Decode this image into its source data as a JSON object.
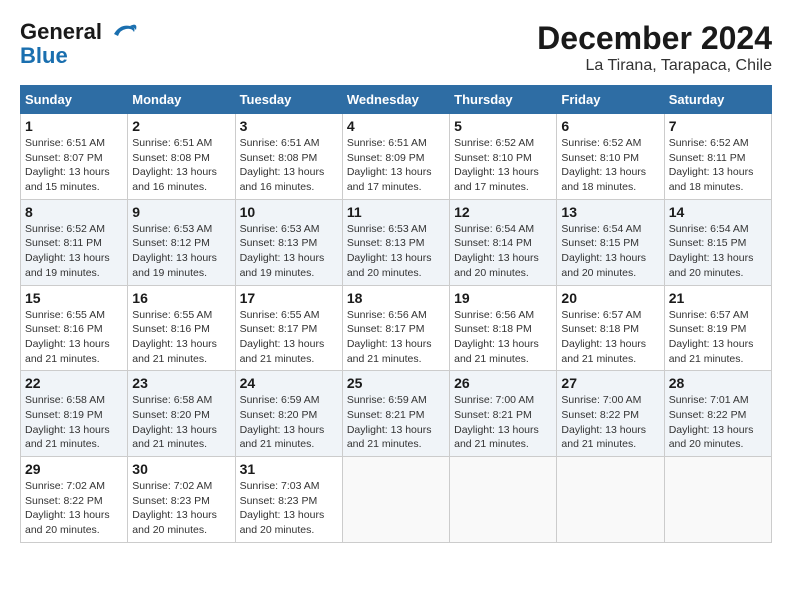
{
  "logo": {
    "line1": "General",
    "line2": "Blue"
  },
  "title": "December 2024",
  "subtitle": "La Tirana, Tarapaca, Chile",
  "days_of_week": [
    "Sunday",
    "Monday",
    "Tuesday",
    "Wednesday",
    "Thursday",
    "Friday",
    "Saturday"
  ],
  "weeks": [
    [
      {
        "day": "1",
        "sunrise": "6:51 AM",
        "sunset": "8:07 PM",
        "daylight": "13 hours and 15 minutes."
      },
      {
        "day": "2",
        "sunrise": "6:51 AM",
        "sunset": "8:08 PM",
        "daylight": "13 hours and 16 minutes."
      },
      {
        "day": "3",
        "sunrise": "6:51 AM",
        "sunset": "8:08 PM",
        "daylight": "13 hours and 16 minutes."
      },
      {
        "day": "4",
        "sunrise": "6:51 AM",
        "sunset": "8:09 PM",
        "daylight": "13 hours and 17 minutes."
      },
      {
        "day": "5",
        "sunrise": "6:52 AM",
        "sunset": "8:10 PM",
        "daylight": "13 hours and 17 minutes."
      },
      {
        "day": "6",
        "sunrise": "6:52 AM",
        "sunset": "8:10 PM",
        "daylight": "13 hours and 18 minutes."
      },
      {
        "day": "7",
        "sunrise": "6:52 AM",
        "sunset": "8:11 PM",
        "daylight": "13 hours and 18 minutes."
      }
    ],
    [
      {
        "day": "8",
        "sunrise": "6:52 AM",
        "sunset": "8:11 PM",
        "daylight": "13 hours and 19 minutes."
      },
      {
        "day": "9",
        "sunrise": "6:53 AM",
        "sunset": "8:12 PM",
        "daylight": "13 hours and 19 minutes."
      },
      {
        "day": "10",
        "sunrise": "6:53 AM",
        "sunset": "8:13 PM",
        "daylight": "13 hours and 19 minutes."
      },
      {
        "day": "11",
        "sunrise": "6:53 AM",
        "sunset": "8:13 PM",
        "daylight": "13 hours and 20 minutes."
      },
      {
        "day": "12",
        "sunrise": "6:54 AM",
        "sunset": "8:14 PM",
        "daylight": "13 hours and 20 minutes."
      },
      {
        "day": "13",
        "sunrise": "6:54 AM",
        "sunset": "8:15 PM",
        "daylight": "13 hours and 20 minutes."
      },
      {
        "day": "14",
        "sunrise": "6:54 AM",
        "sunset": "8:15 PM",
        "daylight": "13 hours and 20 minutes."
      }
    ],
    [
      {
        "day": "15",
        "sunrise": "6:55 AM",
        "sunset": "8:16 PM",
        "daylight": "13 hours and 21 minutes."
      },
      {
        "day": "16",
        "sunrise": "6:55 AM",
        "sunset": "8:16 PM",
        "daylight": "13 hours and 21 minutes."
      },
      {
        "day": "17",
        "sunrise": "6:55 AM",
        "sunset": "8:17 PM",
        "daylight": "13 hours and 21 minutes."
      },
      {
        "day": "18",
        "sunrise": "6:56 AM",
        "sunset": "8:17 PM",
        "daylight": "13 hours and 21 minutes."
      },
      {
        "day": "19",
        "sunrise": "6:56 AM",
        "sunset": "8:18 PM",
        "daylight": "13 hours and 21 minutes."
      },
      {
        "day": "20",
        "sunrise": "6:57 AM",
        "sunset": "8:18 PM",
        "daylight": "13 hours and 21 minutes."
      },
      {
        "day": "21",
        "sunrise": "6:57 AM",
        "sunset": "8:19 PM",
        "daylight": "13 hours and 21 minutes."
      }
    ],
    [
      {
        "day": "22",
        "sunrise": "6:58 AM",
        "sunset": "8:19 PM",
        "daylight": "13 hours and 21 minutes."
      },
      {
        "day": "23",
        "sunrise": "6:58 AM",
        "sunset": "8:20 PM",
        "daylight": "13 hours and 21 minutes."
      },
      {
        "day": "24",
        "sunrise": "6:59 AM",
        "sunset": "8:20 PM",
        "daylight": "13 hours and 21 minutes."
      },
      {
        "day": "25",
        "sunrise": "6:59 AM",
        "sunset": "8:21 PM",
        "daylight": "13 hours and 21 minutes."
      },
      {
        "day": "26",
        "sunrise": "7:00 AM",
        "sunset": "8:21 PM",
        "daylight": "13 hours and 21 minutes."
      },
      {
        "day": "27",
        "sunrise": "7:00 AM",
        "sunset": "8:22 PM",
        "daylight": "13 hours and 21 minutes."
      },
      {
        "day": "28",
        "sunrise": "7:01 AM",
        "sunset": "8:22 PM",
        "daylight": "13 hours and 20 minutes."
      }
    ],
    [
      {
        "day": "29",
        "sunrise": "7:02 AM",
        "sunset": "8:22 PM",
        "daylight": "13 hours and 20 minutes."
      },
      {
        "day": "30",
        "sunrise": "7:02 AM",
        "sunset": "8:23 PM",
        "daylight": "13 hours and 20 minutes."
      },
      {
        "day": "31",
        "sunrise": "7:03 AM",
        "sunset": "8:23 PM",
        "daylight": "13 hours and 20 minutes."
      },
      null,
      null,
      null,
      null
    ]
  ]
}
